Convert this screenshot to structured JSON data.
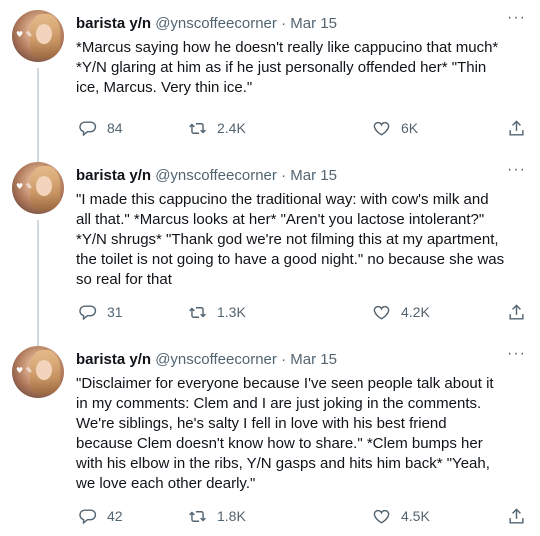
{
  "thread": {
    "tweets": [
      {
        "name": "barista y/n",
        "handle": "@ynscoffeecorner",
        "separator": "·",
        "date": "Mar 15",
        "text": "*Marcus saying how he doesn't really like cappucino that much*\n*Y/N glaring at him as if he just personally offended her* \"Thin\nice, Marcus. Very thin ice.\"",
        "replies": "84",
        "retweets": "2.4K",
        "likes": "6K"
      },
      {
        "name": "barista y/n",
        "handle": "@ynscoffeecorner",
        "separator": "·",
        "date": "Mar 15",
        "text": "\"I made this cappucino the traditional way: with cow's milk and\nall that.\" *Marcus looks at her* \"Aren't you lactose intolerant?\"\n*Y/N shrugs* \"Thank god we're not filming this at my apartment,\nthe toilet is not going to have a good night.\" no because she was\nso real for that",
        "replies": "31",
        "retweets": "1.3K",
        "likes": "4.2K"
      },
      {
        "name": "barista y/n",
        "handle": "@ynscoffeecorner",
        "separator": "·",
        "date": "Mar 15",
        "text": "\"Disclaimer for everyone because I've seen people talk about it\nin my comments: Clem and I are just joking in the comments.\nWe're siblings, he's salty I fell in love with his best friend\nbecause Clem doesn't know how to share.\" *Clem bumps her\nwith his elbow in the ribs, Y/N gasps and hits him back* \"Yeah,\nwe love each other dearly.\"",
        "replies": "42",
        "retweets": "1.8K",
        "likes": "4.5K"
      }
    ]
  },
  "icons": {
    "more": "more-icon",
    "reply": "reply-icon",
    "retweet": "retweet-icon",
    "like": "heart-icon",
    "share": "share-icon"
  },
  "colors": {
    "text": "#0f1419",
    "secondary": "#536471",
    "thread_line": "#cfd9de",
    "background": "#ffffff"
  }
}
